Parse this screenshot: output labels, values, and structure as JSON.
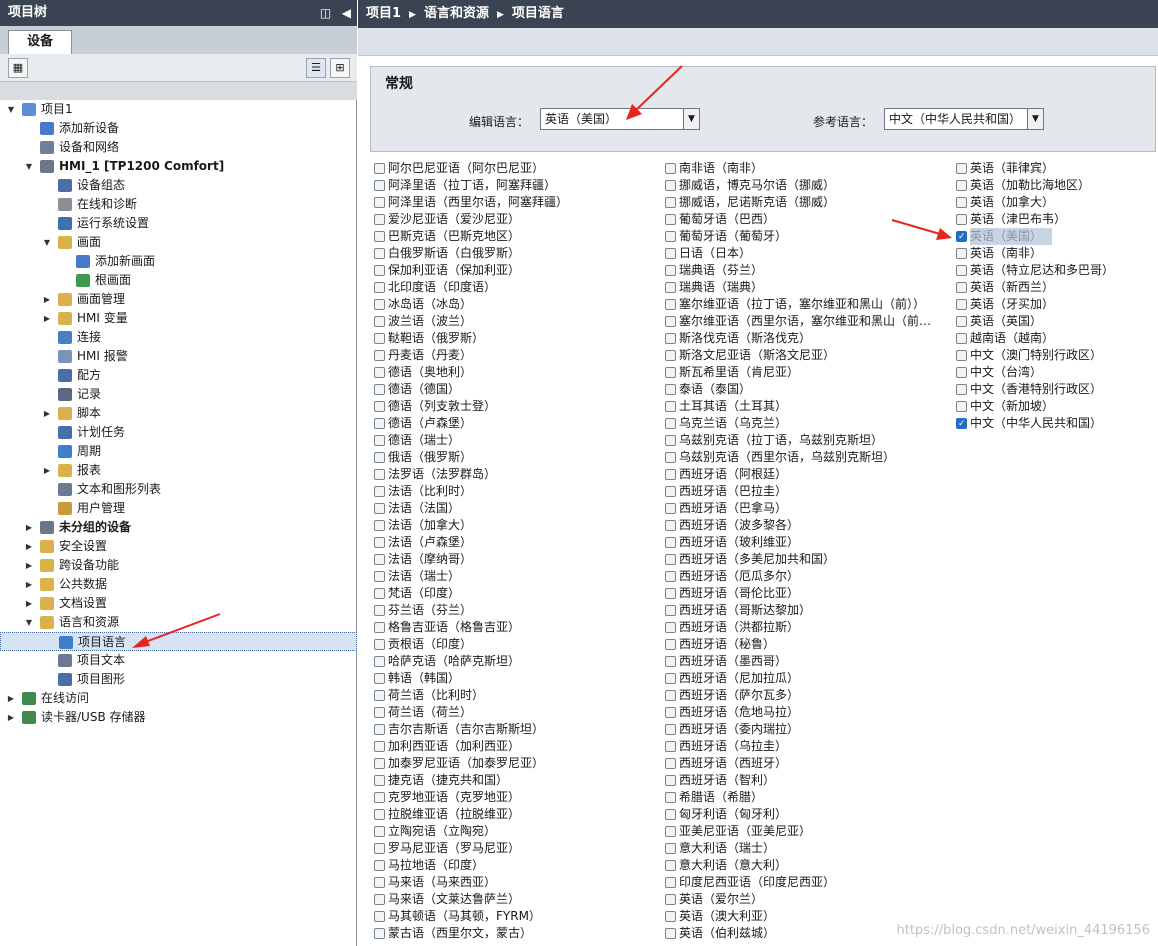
{
  "left": {
    "header": "项目树",
    "tab": "设备",
    "tree": [
      {
        "label": "项目1",
        "level": 0,
        "arrow": "open",
        "bold": false,
        "sel": false,
        "icon": "project-icon",
        "color": "#5a8fd8"
      },
      {
        "label": "添加新设备",
        "level": 1,
        "arrow": "",
        "bold": false,
        "sel": false,
        "icon": "add-device-icon",
        "color": "#4a78c8"
      },
      {
        "label": "设备和网络",
        "level": 1,
        "arrow": "",
        "bold": false,
        "sel": false,
        "icon": "network-icon",
        "color": "#6e7f99"
      },
      {
        "label": "HMI_1 [TP1200 Comfort]",
        "level": 1,
        "arrow": "open",
        "bold": true,
        "sel": false,
        "icon": "hmi-icon",
        "color": "#6b7789"
      },
      {
        "label": "设备组态",
        "level": 2,
        "arrow": "",
        "bold": false,
        "sel": false,
        "icon": "device-config-icon",
        "color": "#4d6fa8"
      },
      {
        "label": "在线和诊断",
        "level": 2,
        "arrow": "",
        "bold": false,
        "sel": false,
        "icon": "diagnostics-icon",
        "color": "#8a8f96"
      },
      {
        "label": "运行系统设置",
        "level": 2,
        "arrow": "",
        "bold": false,
        "sel": false,
        "icon": "wrench-icon",
        "color": "#3f6fb0"
      },
      {
        "label": "画面",
        "level": 2,
        "arrow": "open",
        "bold": false,
        "sel": false,
        "icon": "folder-icon",
        "color": "#d9b24c"
      },
      {
        "label": "添加新画面",
        "level": 3,
        "arrow": "",
        "bold": false,
        "sel": false,
        "icon": "add-screen-icon",
        "color": "#4a78c8"
      },
      {
        "label": "根画面",
        "level": 3,
        "arrow": "",
        "bold": false,
        "sel": false,
        "icon": "screen-icon",
        "color": "#3f9a4e"
      },
      {
        "label": "画面管理",
        "level": 2,
        "arrow": "closed",
        "bold": false,
        "sel": false,
        "icon": "screen-mgmt-icon",
        "color": "#d9b24c"
      },
      {
        "label": "HMI 变量",
        "level": 2,
        "arrow": "closed",
        "bold": false,
        "sel": false,
        "icon": "tags-icon",
        "color": "#d9b24c"
      },
      {
        "label": "连接",
        "level": 2,
        "arrow": "",
        "bold": false,
        "sel": false,
        "icon": "connection-icon",
        "color": "#4a7fc8"
      },
      {
        "label": "HMI 报警",
        "level": 2,
        "arrow": "",
        "bold": false,
        "sel": false,
        "icon": "alarm-icon",
        "color": "#7a93b8"
      },
      {
        "label": "配方",
        "level": 2,
        "arrow": "",
        "bold": false,
        "sel": false,
        "icon": "recipe-icon",
        "color": "#4a6fa8"
      },
      {
        "label": "记录",
        "level": 2,
        "arrow": "",
        "bold": false,
        "sel": false,
        "icon": "log-icon",
        "color": "#5a6a80"
      },
      {
        "label": "脚本",
        "level": 2,
        "arrow": "closed",
        "bold": false,
        "sel": false,
        "icon": "script-icon",
        "color": "#d9b24c"
      },
      {
        "label": "计划任务",
        "level": 2,
        "arrow": "",
        "bold": false,
        "sel": false,
        "icon": "schedule-icon",
        "color": "#4a6fa8"
      },
      {
        "label": "周期",
        "level": 2,
        "arrow": "",
        "bold": false,
        "sel": false,
        "icon": "cycle-icon",
        "color": "#3f7fc8"
      },
      {
        "label": "报表",
        "level": 2,
        "arrow": "closed",
        "bold": false,
        "sel": false,
        "icon": "report-icon",
        "color": "#d9b24c"
      },
      {
        "label": "文本和图形列表",
        "level": 2,
        "arrow": "",
        "bold": false,
        "sel": false,
        "icon": "text-list-icon",
        "color": "#6a7a90"
      },
      {
        "label": "用户管理",
        "level": 2,
        "arrow": "",
        "bold": false,
        "sel": false,
        "icon": "user-mgmt-icon",
        "color": "#c89a3a"
      },
      {
        "label": "未分组的设备",
        "level": 1,
        "arrow": "closed",
        "bold": true,
        "sel": false,
        "icon": "ungrouped-icon",
        "color": "#6b7789"
      },
      {
        "label": "安全设置",
        "level": 1,
        "arrow": "closed",
        "bold": false,
        "sel": false,
        "icon": "security-icon",
        "color": "#d9b24c"
      },
      {
        "label": "跨设备功能",
        "level": 1,
        "arrow": "closed",
        "bold": false,
        "sel": false,
        "icon": "cross-device-icon",
        "color": "#d9b24c"
      },
      {
        "label": "公共数据",
        "level": 1,
        "arrow": "closed",
        "bold": false,
        "sel": false,
        "icon": "common-data-icon",
        "color": "#d9b24c"
      },
      {
        "label": "文档设置",
        "level": 1,
        "arrow": "closed",
        "bold": false,
        "sel": false,
        "icon": "doc-settings-icon",
        "color": "#d9b24c"
      },
      {
        "label": "语言和资源",
        "level": 1,
        "arrow": "open",
        "bold": false,
        "sel": false,
        "icon": "languages-icon",
        "color": "#d9b24c"
      },
      {
        "label": "项目语言",
        "level": 2,
        "arrow": "",
        "bold": false,
        "sel": true,
        "icon": "project-languages-icon",
        "color": "#3f7fc8"
      },
      {
        "label": "项目文本",
        "level": 2,
        "arrow": "",
        "bold": false,
        "sel": false,
        "icon": "project-texts-icon",
        "color": "#6a7a90"
      },
      {
        "label": "项目图形",
        "level": 2,
        "arrow": "",
        "bold": false,
        "sel": false,
        "icon": "project-graphics-icon",
        "color": "#4a6fa8"
      },
      {
        "label": "在线访问",
        "level": 0,
        "arrow": "closed",
        "bold": false,
        "sel": false,
        "icon": "online-access-icon",
        "color": "#3f8a4e"
      },
      {
        "label": "读卡器/USB 存储器",
        "level": 0,
        "arrow": "closed",
        "bold": false,
        "sel": false,
        "icon": "usb-icon",
        "color": "#3f8a4e"
      }
    ]
  },
  "right": {
    "breadcrumb": [
      "项目1",
      "语言和资源",
      "项目语言"
    ],
    "section_title": "常规",
    "edit_label": "编辑语言：",
    "edit_value": "英语（美国）",
    "ref_label": "参考语言：",
    "ref_value": "中文（中华人民共和国）",
    "col1": [
      {
        "t": "阿尔巴尼亚语（阿尔巴尼亚）",
        "c": false
      },
      {
        "t": "阿泽里语（拉丁语，阿塞拜疆）",
        "c": false
      },
      {
        "t": "阿泽里语（西里尔语，阿塞拜疆）",
        "c": false
      },
      {
        "t": "爱沙尼亚语（爱沙尼亚）",
        "c": false
      },
      {
        "t": "巴斯克语（巴斯克地区）",
        "c": false
      },
      {
        "t": "白俄罗斯语（白俄罗斯）",
        "c": false
      },
      {
        "t": "保加利亚语（保加利亚）",
        "c": false
      },
      {
        "t": "北印度语（印度语）",
        "c": false
      },
      {
        "t": "冰岛语（冰岛）",
        "c": false
      },
      {
        "t": "波兰语（波兰）",
        "c": false
      },
      {
        "t": "鞑靼语（俄罗斯）",
        "c": false
      },
      {
        "t": "丹麦语（丹麦）",
        "c": false
      },
      {
        "t": "德语（奥地利）",
        "c": false
      },
      {
        "t": "德语（德国）",
        "c": false
      },
      {
        "t": "德语（列支敦士登）",
        "c": false
      },
      {
        "t": "德语（卢森堡）",
        "c": false
      },
      {
        "t": "德语（瑞士）",
        "c": false
      },
      {
        "t": "俄语（俄罗斯）",
        "c": false
      },
      {
        "t": "法罗语（法罗群岛）",
        "c": false
      },
      {
        "t": "法语（比利时）",
        "c": false
      },
      {
        "t": "法语（法国）",
        "c": false
      },
      {
        "t": "法语（加拿大）",
        "c": false
      },
      {
        "t": "法语（卢森堡）",
        "c": false
      },
      {
        "t": "法语（摩纳哥）",
        "c": false
      },
      {
        "t": "法语（瑞士）",
        "c": false
      },
      {
        "t": "梵语（印度）",
        "c": false
      },
      {
        "t": "芬兰语（芬兰）",
        "c": false
      },
      {
        "t": "格鲁吉亚语（格鲁吉亚）",
        "c": false
      },
      {
        "t": "贡根语（印度）",
        "c": false
      },
      {
        "t": "哈萨克语（哈萨克斯坦）",
        "c": false
      },
      {
        "t": "韩语（韩国）",
        "c": false
      },
      {
        "t": "荷兰语（比利时）",
        "c": false
      },
      {
        "t": "荷兰语（荷兰）",
        "c": false
      },
      {
        "t": "吉尔吉斯语（吉尔吉斯斯坦）",
        "c": false
      },
      {
        "t": "加利西亚语（加利西亚）",
        "c": false
      },
      {
        "t": "加泰罗尼亚语（加泰罗尼亚）",
        "c": false
      },
      {
        "t": "捷克语（捷克共和国）",
        "c": false
      },
      {
        "t": "克罗地亚语（克罗地亚）",
        "c": false
      },
      {
        "t": "拉脱维亚语（拉脱维亚）",
        "c": false
      },
      {
        "t": "立陶宛语（立陶宛）",
        "c": false
      },
      {
        "t": "罗马尼亚语（罗马尼亚）",
        "c": false
      },
      {
        "t": "马拉地语（印度）",
        "c": false
      },
      {
        "t": "马来语（马来西亚）",
        "c": false
      },
      {
        "t": "马来语（文莱达鲁萨兰）",
        "c": false
      },
      {
        "t": "马其顿语（马其顿，FYRM）",
        "c": false
      },
      {
        "t": "蒙古语（西里尔文，蒙古）",
        "c": false
      }
    ],
    "col2": [
      {
        "t": "南非语（南非）",
        "c": false
      },
      {
        "t": "挪威语，博克马尔语（挪威）",
        "c": false
      },
      {
        "t": "挪威语，尼诺斯克语（挪威）",
        "c": false
      },
      {
        "t": "葡萄牙语（巴西）",
        "c": false
      },
      {
        "t": "葡萄牙语（葡萄牙）",
        "c": false
      },
      {
        "t": "日语（日本）",
        "c": false
      },
      {
        "t": "瑞典语（芬兰）",
        "c": false
      },
      {
        "t": "瑞典语（瑞典）",
        "c": false
      },
      {
        "t": "塞尔维亚语（拉丁语，塞尔维亚和黑山（前））",
        "c": false
      },
      {
        "t": "塞尔维亚语（西里尔语，塞尔维亚和黑山（前…",
        "c": false
      },
      {
        "t": "斯洛伐克语（斯洛伐克）",
        "c": false
      },
      {
        "t": "斯洛文尼亚语（斯洛文尼亚）",
        "c": false
      },
      {
        "t": "斯瓦希里语（肯尼亚）",
        "c": false
      },
      {
        "t": "泰语（泰国）",
        "c": false
      },
      {
        "t": "土耳其语（土耳其）",
        "c": false
      },
      {
        "t": "乌克兰语（乌克兰）",
        "c": false
      },
      {
        "t": "乌兹别克语（拉丁语，乌兹别克斯坦）",
        "c": false
      },
      {
        "t": "乌兹别克语（西里尔语，乌兹别克斯坦）",
        "c": false
      },
      {
        "t": "西班牙语（阿根廷）",
        "c": false
      },
      {
        "t": "西班牙语（巴拉圭）",
        "c": false
      },
      {
        "t": "西班牙语（巴拿马）",
        "c": false
      },
      {
        "t": "西班牙语（波多黎各）",
        "c": false
      },
      {
        "t": "西班牙语（玻利维亚）",
        "c": false
      },
      {
        "t": "西班牙语（多美尼加共和国）",
        "c": false
      },
      {
        "t": "西班牙语（厄瓜多尔）",
        "c": false
      },
      {
        "t": "西班牙语（哥伦比亚）",
        "c": false
      },
      {
        "t": "西班牙语（哥斯达黎加）",
        "c": false
      },
      {
        "t": "西班牙语（洪都拉斯）",
        "c": false
      },
      {
        "t": "西班牙语（秘鲁）",
        "c": false
      },
      {
        "t": "西班牙语（墨西哥）",
        "c": false
      },
      {
        "t": "西班牙语（尼加拉瓜）",
        "c": false
      },
      {
        "t": "西班牙语（萨尔瓦多）",
        "c": false
      },
      {
        "t": "西班牙语（危地马拉）",
        "c": false
      },
      {
        "t": "西班牙语（委内瑞拉）",
        "c": false
      },
      {
        "t": "西班牙语（乌拉圭）",
        "c": false
      },
      {
        "t": "西班牙语（西班牙）",
        "c": false
      },
      {
        "t": "西班牙语（智利）",
        "c": false
      },
      {
        "t": "希腊语（希腊）",
        "c": false
      },
      {
        "t": "匈牙利语（匈牙利）",
        "c": false
      },
      {
        "t": "亚美尼亚语（亚美尼亚）",
        "c": false
      },
      {
        "t": "意大利语（瑞士）",
        "c": false
      },
      {
        "t": "意大利语（意大利）",
        "c": false
      },
      {
        "t": "印度尼西亚语（印度尼西亚）",
        "c": false
      },
      {
        "t": "英语（爱尔兰）",
        "c": false
      },
      {
        "t": "英语（澳大利亚）",
        "c": false
      },
      {
        "t": "英语（伯利兹城）",
        "c": false
      }
    ],
    "col3": [
      {
        "t": "英语（菲律宾）",
        "c": false
      },
      {
        "t": "英语（加勒比海地区）",
        "c": false
      },
      {
        "t": "英语（加拿大）",
        "c": false
      },
      {
        "t": "英语（津巴布韦）",
        "c": false
      },
      {
        "t": "英语（美国）",
        "c": true,
        "hl": true
      },
      {
        "t": "英语（南非）",
        "c": false
      },
      {
        "t": "英语（特立尼达和多巴哥）",
        "c": false
      },
      {
        "t": "英语（新西兰）",
        "c": false
      },
      {
        "t": "英语（牙买加）",
        "c": false
      },
      {
        "t": "英语（英国）",
        "c": false
      },
      {
        "t": "越南语（越南）",
        "c": false
      },
      {
        "t": "中文（澳门特别行政区）",
        "c": false
      },
      {
        "t": "中文（台湾）",
        "c": false
      },
      {
        "t": "中文（香港特别行政区）",
        "c": false
      },
      {
        "t": "中文（新加坡）",
        "c": false
      },
      {
        "t": "中文（中华人民共和国）",
        "c": true
      }
    ],
    "watermark": "https://blog.csdn.net/weixin_44196156"
  },
  "colors": {
    "header_bg": "#3b4453",
    "accent": "#1f6fc5",
    "arrow": "#e8241e",
    "selection": "#d7e4f5"
  }
}
